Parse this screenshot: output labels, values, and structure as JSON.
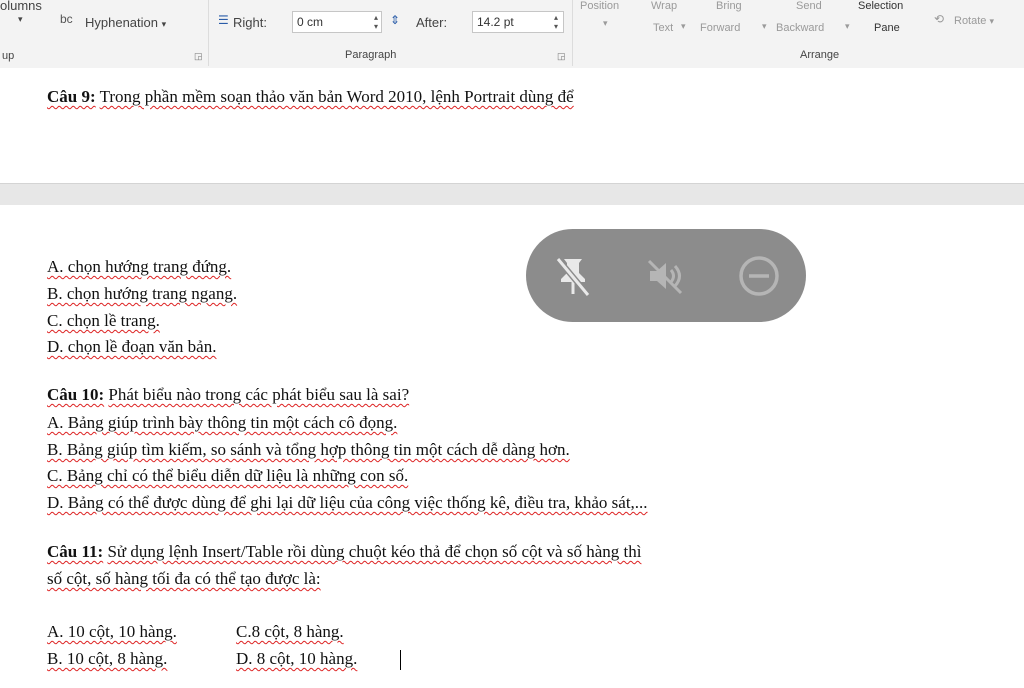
{
  "ribbon": {
    "columns_label": "olumns",
    "hyphenation_label": "Hyphenation",
    "hyphenation_glyph": "bc",
    "setup_group": "up",
    "right_label": "Right:",
    "right_value": "0 cm",
    "after_label": "After:",
    "after_value": "14.2 pt",
    "paragraph_group": "Paragraph",
    "position_label": "Position",
    "wrap_text_label": [
      "Wrap",
      "Text"
    ],
    "bring_forward_label": [
      "Bring",
      "Forward"
    ],
    "send_backward_label": [
      "Send",
      "Backward"
    ],
    "selection_pane_label": [
      "Selection",
      "Pane"
    ],
    "rotate_label": "Rotate",
    "arrange_group": "Arrange"
  },
  "document": {
    "q9": {
      "num": "Câu 9:",
      "text": "Trong phần mềm soạn thảo văn bản Word 2010, lệnh Portrait dùng để"
    },
    "q9_options": [
      "A. chọn hướng trang đứng.",
      "B. chọn hướng trang ngang.",
      "C. chọn lề trang.",
      "D. chọn lề đoạn văn bản."
    ],
    "q10": {
      "num": "Câu 10:",
      "text": "Phát biểu nào trong các phát biểu sau là sai?"
    },
    "q10_options": [
      "A. Bảng giúp trình bày thông tin một cách cô đọng.",
      "B. Bảng giúp tìm kiếm, so sánh và tổng hợp thông tin một cách dễ dàng hơn.",
      "C. Bảng chỉ có thể biểu diễn dữ liệu là những con số.",
      "D. Bảng có thể được dùng để ghi lại dữ liệu của công việc thống kê, điều tra, khảo sát,..."
    ],
    "q11": {
      "num": "Câu 11:",
      "text": "Sử dụng lệnh Insert/Table rồi dùng chuột kéo thả để chọn số cột và số hàng thì",
      "text2": "số cột, số hàng tối đa có thể tạo được là:"
    },
    "q11_options": {
      "a": "A. 10 cột, 10 hàng.",
      "c": "C.8 cột, 8 hàng.",
      "b": "B. 10 cột, 8 hàng.",
      "d": "D. 8 cột, 10 hàng."
    }
  },
  "overlay": {
    "icons": [
      "unpin-icon",
      "mute-icon",
      "minimize-icon"
    ],
    "color": "#8c8c8c"
  }
}
